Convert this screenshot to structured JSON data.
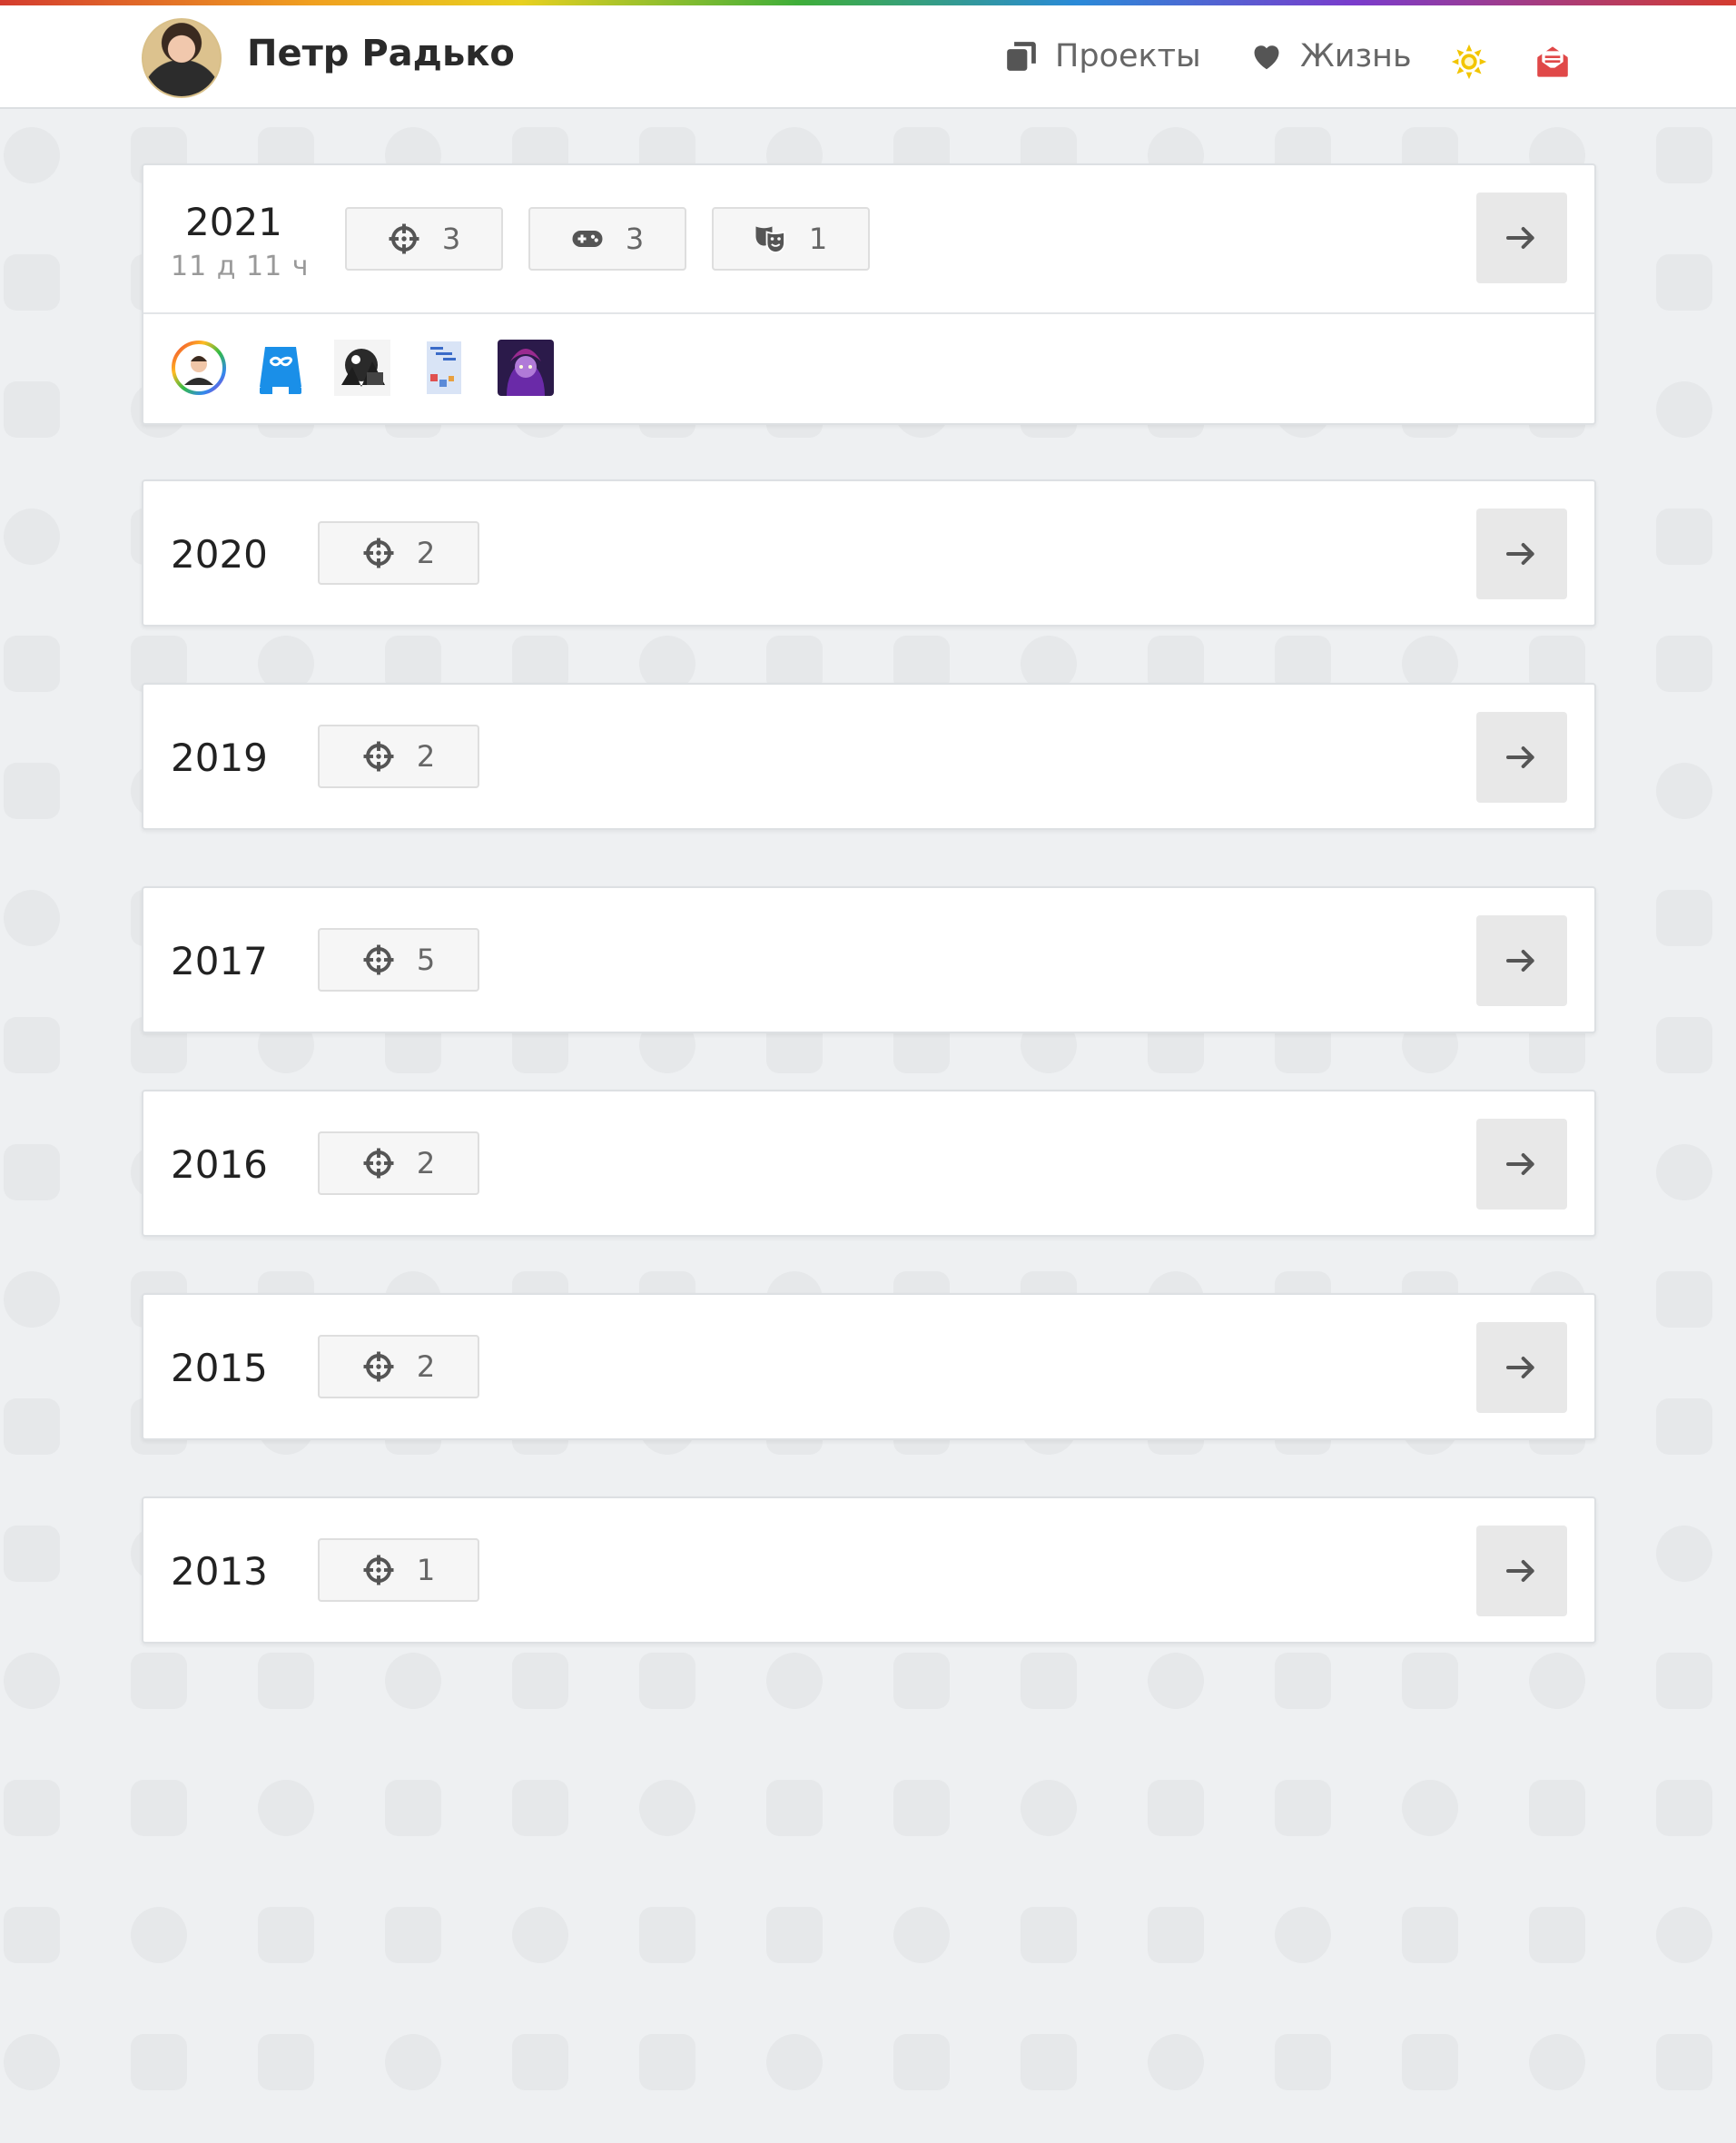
{
  "header": {
    "user_name": "Петр Радько",
    "nav": {
      "projects_label": "Проекты",
      "life_label": "Жизнь"
    },
    "colors": {
      "theme_icon": "#f2c500",
      "mail_icon": "#e04848"
    }
  },
  "years": [
    {
      "year": "2021",
      "duration": "11 д 11 ч",
      "stats": [
        {
          "icon": "crosshair-icon",
          "count": "3"
        },
        {
          "icon": "gamepad-icon",
          "count": "3"
        },
        {
          "icon": "theater-masks-icon",
          "count": "1"
        }
      ],
      "thumbnails": [
        "avatar-thumbnail",
        "blue-infinity-app-thumbnail",
        "dark-art-thumbnail",
        "blue-poster-thumbnail",
        "purple-character-thumbnail"
      ]
    },
    {
      "year": "2020",
      "stats": [
        {
          "icon": "crosshair-icon",
          "count": "2"
        }
      ]
    },
    {
      "year": "2019",
      "stats": [
        {
          "icon": "crosshair-icon",
          "count": "2"
        }
      ]
    },
    {
      "year": "2017",
      "stats": [
        {
          "icon": "crosshair-icon",
          "count": "5"
        }
      ]
    },
    {
      "year": "2016",
      "stats": [
        {
          "icon": "crosshair-icon",
          "count": "2"
        }
      ]
    },
    {
      "year": "2015",
      "stats": [
        {
          "icon": "crosshair-icon",
          "count": "2"
        }
      ]
    },
    {
      "year": "2013",
      "stats": [
        {
          "icon": "crosshair-icon",
          "count": "1"
        }
      ]
    }
  ]
}
